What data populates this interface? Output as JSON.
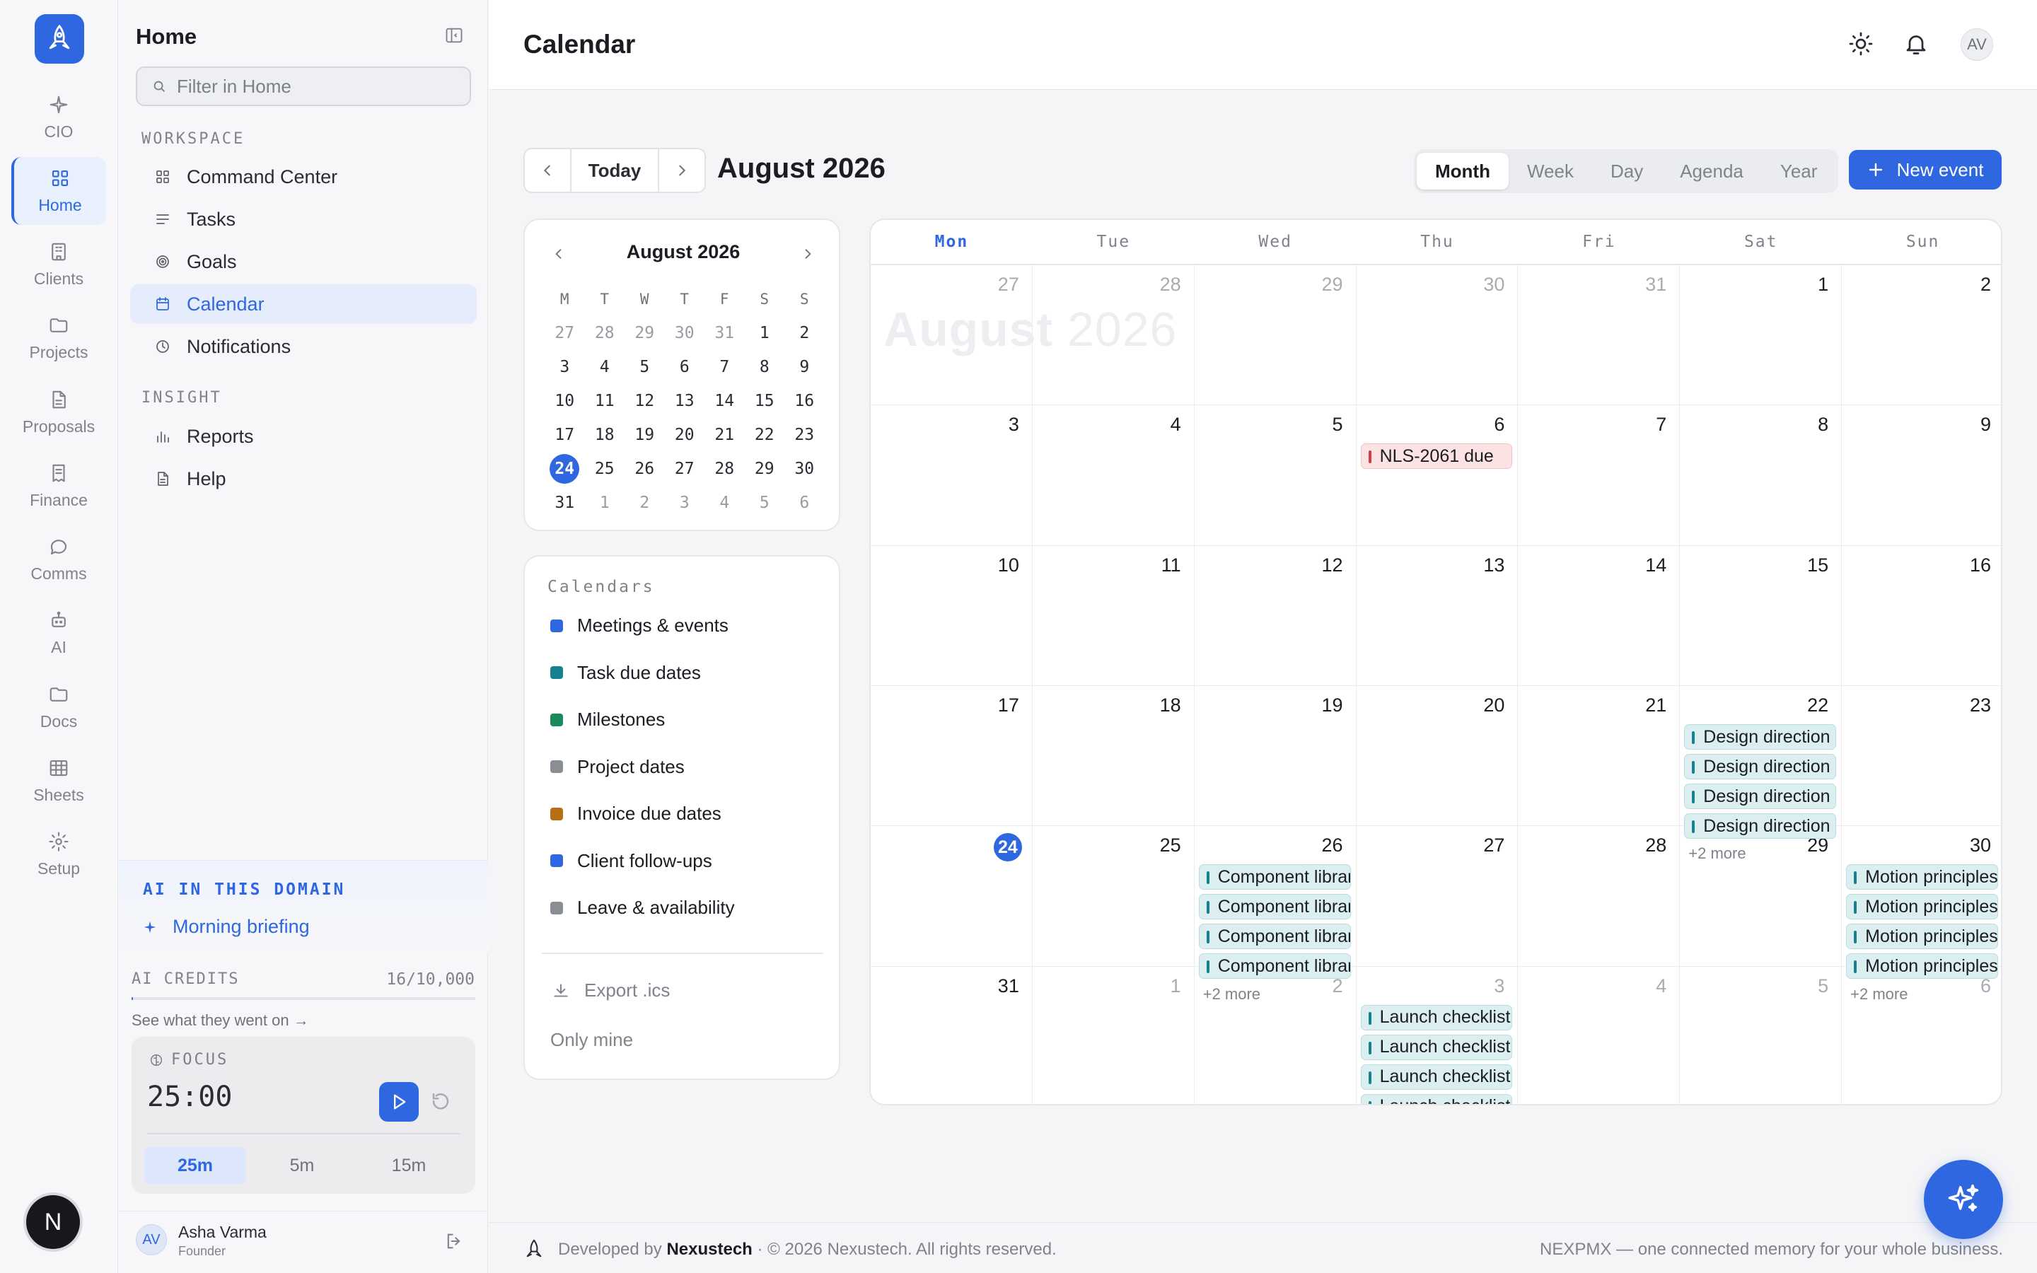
{
  "rail": {
    "items": [
      {
        "label": "CIO",
        "icon": "sparkle-icon"
      },
      {
        "label": "Home",
        "icon": "grid-icon",
        "active": true
      },
      {
        "label": "Clients",
        "icon": "building-icon"
      },
      {
        "label": "Projects",
        "icon": "folder-icon"
      },
      {
        "label": "Proposals",
        "icon": "document-icon"
      },
      {
        "label": "Finance",
        "icon": "receipt-icon"
      },
      {
        "label": "Comms",
        "icon": "chat-icon"
      },
      {
        "label": "AI",
        "icon": "robot-icon"
      },
      {
        "label": "Docs",
        "icon": "folder-icon"
      },
      {
        "label": "Sheets",
        "icon": "table-icon"
      },
      {
        "label": "Setup",
        "icon": "gear-icon"
      }
    ],
    "bottom_badge": "N"
  },
  "sidebar": {
    "title": "Home",
    "search_placeholder": "Filter in Home",
    "workspace_label": "WORKSPACE",
    "workspace_items": [
      {
        "label": "Command Center",
        "icon": "grid-icon"
      },
      {
        "label": "Tasks",
        "icon": "list-icon"
      },
      {
        "label": "Goals",
        "icon": "target-icon"
      },
      {
        "label": "Calendar",
        "icon": "calendar-icon",
        "active": true
      },
      {
        "label": "Notifications",
        "icon": "clock-icon"
      }
    ],
    "insight_label": "INSIGHT",
    "insight_items": [
      {
        "label": "Reports",
        "icon": "bar-chart-icon"
      },
      {
        "label": "Help",
        "icon": "document-icon"
      }
    ],
    "ai_title": "AI IN THIS DOMAIN",
    "ai_link": "Morning briefing",
    "credits_label": "AI CREDITS",
    "credits_value": "16/10,000",
    "credits_used": 16,
    "credits_total": 10000,
    "credits_link": "See what they went on →",
    "focus_label": "FOCUS",
    "focus_time": "25:00",
    "focus_options": [
      "25m",
      "5m",
      "15m"
    ],
    "focus_selected": "25m",
    "user_initials": "AV",
    "user_name": "Asha Varma",
    "user_role": "Founder"
  },
  "header": {
    "title": "Calendar",
    "avatar_initials": "AV"
  },
  "toolbar": {
    "today_label": "Today",
    "month_title": "August 2026",
    "views": [
      "Month",
      "Week",
      "Day",
      "Agenda",
      "Year"
    ],
    "active_view": "Month",
    "new_event_label": "New event"
  },
  "mini_calendar": {
    "title": "August 2026",
    "weekdays": [
      "M",
      "T",
      "W",
      "T",
      "F",
      "S",
      "S"
    ],
    "today": 24,
    "weeks": [
      [
        "27",
        "28",
        "29",
        "30",
        "31",
        "1",
        "2"
      ],
      [
        "3",
        "4",
        "5",
        "6",
        "7",
        "8",
        "9"
      ],
      [
        "10",
        "11",
        "12",
        "13",
        "14",
        "15",
        "16"
      ],
      [
        "17",
        "18",
        "19",
        "20",
        "21",
        "22",
        "23"
      ],
      [
        "24",
        "25",
        "26",
        "27",
        "28",
        "29",
        "30"
      ],
      [
        "31",
        "1",
        "2",
        "3",
        "4",
        "5",
        "6"
      ]
    ]
  },
  "calendars": {
    "title": "Calendars",
    "items": [
      {
        "label": "Meetings & events",
        "color": "#2f67e0"
      },
      {
        "label": "Task due dates",
        "color": "#17818f"
      },
      {
        "label": "Milestones",
        "color": "#198a5c"
      },
      {
        "label": "Project dates",
        "color": "#8b8d95"
      },
      {
        "label": "Invoice due dates",
        "color": "#b86e14"
      },
      {
        "label": "Client follow-ups",
        "color": "#2f67e0"
      },
      {
        "label": "Leave & availability",
        "color": "#8b8d95"
      }
    ],
    "export_label": "Export .ics",
    "only_mine_label": "Only mine"
  },
  "month_grid": {
    "weekdays": [
      "Mon",
      "Tue",
      "Wed",
      "Thu",
      "Fri",
      "Sat",
      "Sun"
    ],
    "current_weekday": "Mon",
    "watermark_month": "August",
    "watermark_year": "2026",
    "weeks": [
      [
        {
          "n": "27",
          "m": true
        },
        {
          "n": "28",
          "m": true
        },
        {
          "n": "29",
          "m": true
        },
        {
          "n": "30",
          "m": true
        },
        {
          "n": "31",
          "m": true
        },
        {
          "n": "1"
        },
        {
          "n": "2"
        }
      ],
      [
        {
          "n": "3"
        },
        {
          "n": "4"
        },
        {
          "n": "5"
        },
        {
          "n": "6",
          "events": [
            {
              "t": "NLS-2061 due",
              "k": "red"
            }
          ]
        },
        {
          "n": "7"
        },
        {
          "n": "8"
        },
        {
          "n": "9"
        }
      ],
      [
        {
          "n": "10"
        },
        {
          "n": "11"
        },
        {
          "n": "12"
        },
        {
          "n": "13"
        },
        {
          "n": "14"
        },
        {
          "n": "15"
        },
        {
          "n": "16"
        }
      ],
      [
        {
          "n": "17"
        },
        {
          "n": "18"
        },
        {
          "n": "19"
        },
        {
          "n": "20"
        },
        {
          "n": "21"
        },
        {
          "n": "22",
          "events": [
            {
              "t": "Design direction review",
              "k": "teal"
            },
            {
              "t": "Design direction review",
              "k": "teal"
            },
            {
              "t": "Design direction review",
              "k": "teal"
            },
            {
              "t": "Design direction review",
              "k": "teal"
            }
          ],
          "more": "+2 more"
        },
        {
          "n": "23"
        }
      ],
      [
        {
          "n": "24",
          "today": true
        },
        {
          "n": "25"
        },
        {
          "n": "26",
          "events": [
            {
              "t": "Component library",
              "k": "teal"
            },
            {
              "t": "Component library",
              "k": "teal"
            },
            {
              "t": "Component library",
              "k": "teal"
            },
            {
              "t": "Component library",
              "k": "teal"
            }
          ],
          "more": "+2 more"
        },
        {
          "n": "27"
        },
        {
          "n": "28"
        },
        {
          "n": "29"
        },
        {
          "n": "30",
          "events": [
            {
              "t": "Motion principles",
              "k": "teal"
            },
            {
              "t": "Motion principles",
              "k": "teal"
            },
            {
              "t": "Motion principles",
              "k": "teal"
            },
            {
              "t": "Motion principles",
              "k": "teal"
            }
          ],
          "more": "+2 more"
        }
      ],
      [
        {
          "n": "31"
        },
        {
          "n": "1",
          "m": true
        },
        {
          "n": "2",
          "m": true
        },
        {
          "n": "3",
          "m": true,
          "events": [
            {
              "t": "Launch checklist",
              "k": "teal"
            },
            {
              "t": "Launch checklist",
              "k": "teal"
            },
            {
              "t": "Launch checklist",
              "k": "teal"
            },
            {
              "t": "Launch checklist",
              "k": "teal"
            }
          ]
        },
        {
          "n": "4",
          "m": true
        },
        {
          "n": "5",
          "m": true
        },
        {
          "n": "6",
          "m": true
        }
      ]
    ]
  },
  "footer": {
    "developed_by": "Developed by",
    "company": "Nexustech",
    "copyright": "· © 2026 Nexustech. All rights reserved.",
    "tagline": "NEXPMX — one connected memory for your whole business."
  }
}
